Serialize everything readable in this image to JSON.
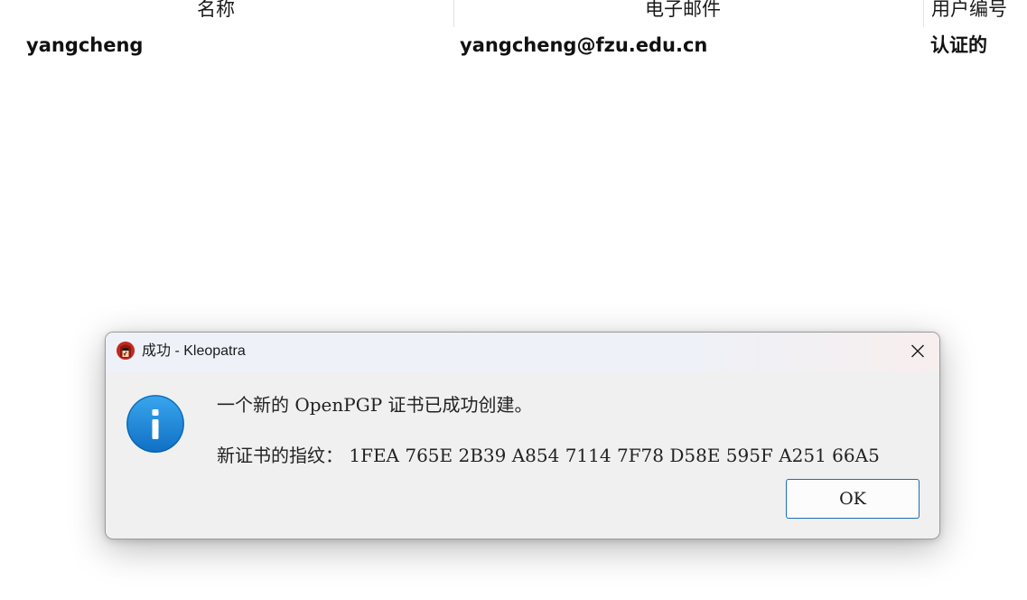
{
  "table": {
    "headers": {
      "name": "名称",
      "email": "电子邮件",
      "user_id": "用户编号"
    },
    "rows": [
      {
        "name": "yangcheng",
        "email": "yangcheng@fzu.edu.cn",
        "user_id": "认证的"
      }
    ]
  },
  "dialog": {
    "title": "成功 - Kleopatra",
    "message": "一个新的 OpenPGP 证书已成功创建。",
    "fingerprint_line": "新证书的指纹：  1FEA 765E 2B39 A854 7114  7F78 D58E 595F A251 66A5",
    "ok_label": "OK",
    "app_icon": "kleopatra-icon",
    "info_icon": "info-icon",
    "close_icon": "close-icon",
    "colors": {
      "accent": "#1a6fb5",
      "info_blue": "#1f8fe0",
      "app_icon_red": "#c8261c"
    }
  }
}
